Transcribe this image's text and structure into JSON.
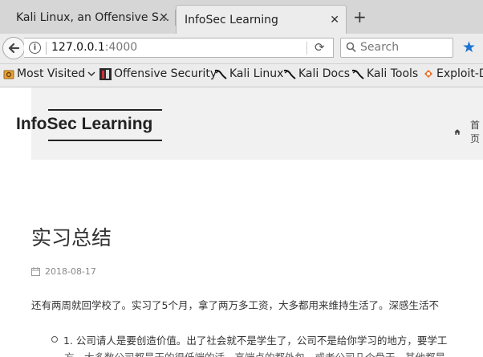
{
  "tabs": [
    {
      "title": "Kali Linux, an Offensive S...",
      "active": false
    },
    {
      "title": "InfoSec Learning",
      "active": true
    }
  ],
  "toolbar": {
    "url_host": "127.0.0.1",
    "url_port": ":4000",
    "search_placeholder": "Search"
  },
  "bookmarks": [
    {
      "label": "Most Visited",
      "icon": "gear-icon"
    },
    {
      "label": "Offensive Security",
      "icon": "offsec-icon"
    },
    {
      "label": "Kali Linux",
      "icon": "kali-dragon-icon"
    },
    {
      "label": "Kali Docs",
      "icon": "kali-dragon-icon"
    },
    {
      "label": "Kali Tools",
      "icon": "kali-dragon-icon"
    },
    {
      "label": "Exploit-D",
      "icon": "exploit-db-icon"
    }
  ],
  "site": {
    "logo": "InfoSec Learning",
    "menu_home": "首页"
  },
  "post": {
    "title": "实习总结",
    "date": "2018-08-17",
    "intro": "还有两周就回学校了。实习了5个月，拿了两万多工资，大多都用来维持生活了。深感生活不",
    "list_items": [
      {
        "text": "1. 公司请人是要创造价值。出了社会就不是学生了，公司不是给你学习的地方，要学工",
        "cont": "方，大多数公司都是干的很低端的活，高端点的都外包，或者公司几个骨干，其他都是"
      }
    ]
  }
}
